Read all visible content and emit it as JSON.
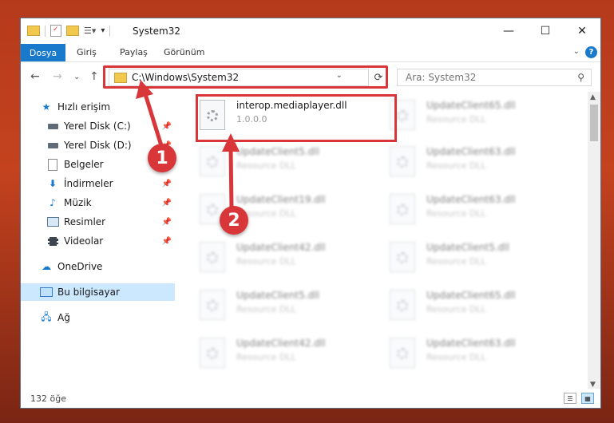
{
  "window": {
    "title": "System32",
    "controls": {
      "minimize": "—",
      "maximize": "☐",
      "close": "✕"
    }
  },
  "ribbon": {
    "tabs": [
      "Dosya",
      "Giriş",
      "Paylaş",
      "Görünüm"
    ],
    "help": "?"
  },
  "navigation": {
    "address": "C:\\Windows\\System32",
    "search_placeholder": "Ara: System32"
  },
  "sidebar": {
    "items": [
      {
        "label": "Hızlı erişim",
        "icon": "star-icon",
        "pinned": false
      },
      {
        "label": "Yerel Disk (C:)",
        "icon": "drive-icon",
        "pinned": true
      },
      {
        "label": "Yerel Disk (D:)",
        "icon": "drive-icon",
        "pinned": true
      },
      {
        "label": "Belgeler",
        "icon": "document-icon",
        "pinned": true
      },
      {
        "label": "İndirmeler",
        "icon": "download-icon",
        "pinned": true
      },
      {
        "label": "Müzik",
        "icon": "music-icon",
        "pinned": true
      },
      {
        "label": "Resimler",
        "icon": "picture-icon",
        "pinned": true
      },
      {
        "label": "Videolar",
        "icon": "video-icon",
        "pinned": true
      },
      {
        "label": "OneDrive",
        "icon": "cloud-icon",
        "pinned": false
      },
      {
        "label": "Bu bilgisayar",
        "icon": "computer-icon",
        "pinned": false,
        "selected": true
      },
      {
        "label": "Ağ",
        "icon": "network-icon",
        "pinned": false
      }
    ]
  },
  "files": [
    {
      "name": "interop.mediaplayer.dll",
      "sub": "1.0.0.0",
      "highlighted": true
    },
    {
      "name": "UpdateClient65.dll",
      "sub": "Resource DLL"
    },
    {
      "name": "UpdateClient5.dll",
      "sub": "Resource DLL"
    },
    {
      "name": "UpdateClient63.dll",
      "sub": "Resource DLL"
    },
    {
      "name": "UpdateClient19.dll",
      "sub": "Resource DLL"
    },
    {
      "name": "UpdateClient63.dll",
      "sub": "Resource DLL"
    },
    {
      "name": "UpdateClient42.dll",
      "sub": "Resource DLL"
    },
    {
      "name": "UpdateClient5.dll",
      "sub": "Resource DLL"
    },
    {
      "name": "UpdateClient5.dll",
      "sub": "Resource DLL"
    },
    {
      "name": "UpdateClient65.dll",
      "sub": "Resource DLL"
    },
    {
      "name": "UpdateClient42.dll",
      "sub": "Resource DLL"
    },
    {
      "name": "UpdateClient63.dll",
      "sub": "Resource DLL"
    }
  ],
  "status": {
    "count": "132 öğe"
  },
  "annotations": {
    "marker1": "1",
    "marker2": "2"
  },
  "colors": {
    "accent": "#1979ca",
    "highlight": "#d9363a",
    "selected": "#cce8ff"
  }
}
